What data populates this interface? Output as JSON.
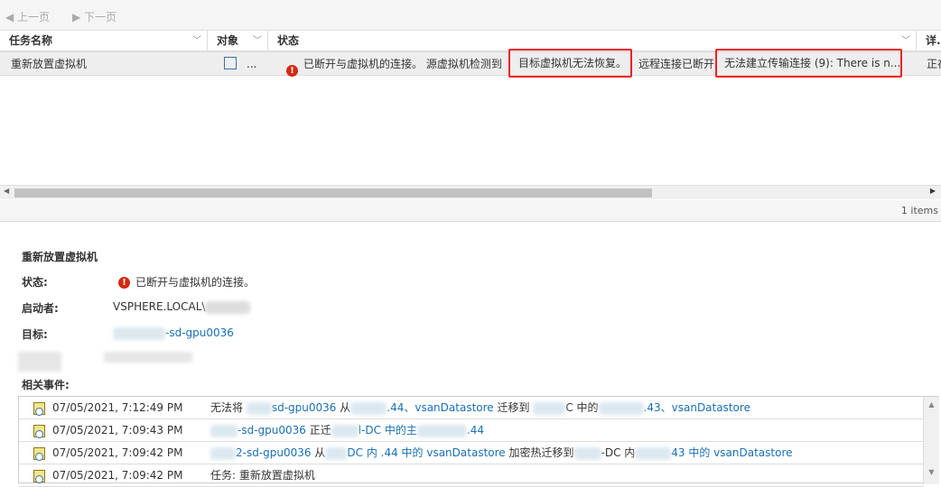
{
  "nav": {
    "prev": "上一页",
    "next": "下一页"
  },
  "columns": [
    "任务名称",
    "对象",
    "状态",
    "详..."
  ],
  "task_row": {
    "name": "重新放置虚拟机",
    "object": "...",
    "status_part1": "已断开与虚拟机的连接。 源虚拟机检测到",
    "status_box1": "目标虚拟机无法恢复。",
    "status_part2": "远程连接已断开",
    "status_box2": "无法建立传输连接 (9): There is n...",
    "detail": "正在"
  },
  "footer": {
    "count": "1 items"
  },
  "detail": {
    "title": "重新放置虚拟机",
    "status_label": "状态:",
    "status_value": "已断开与虚拟机的连接。",
    "initiator_label": "启动者:",
    "initiator_value": "VSPHERE.LOCAL\\",
    "target_label": "目标:",
    "target_value": "-sd-gpu0036",
    "events_label": "相关事件:"
  },
  "events": [
    {
      "time": "07/05/2021, 7:12:49 PM",
      "a": "无法将",
      "b": "sd-gpu0036",
      "c": "从",
      "d": ".44、vsanDatastore",
      "e": "迁移到",
      "f": "C 中的",
      "g": ".43、vsanDatastore"
    },
    {
      "time": "07/05/2021, 7:09:43 PM",
      "a": "",
      "b": "-sd-gpu0036",
      "c": "正迁",
      "d": "l-DC 中的主",
      "e": "",
      "f": "",
      "g": ".44"
    },
    {
      "time": "07/05/2021, 7:09:42 PM",
      "a": "",
      "b": "2-sd-gpu0036",
      "c": "从",
      "d": "DC 内 .44 中的 vsanDatastore",
      "e": "加密热迁移到",
      "f": "-DC 内",
      "g": "43 中的 vsanDatastore"
    },
    {
      "time": "07/05/2021, 7:09:42 PM",
      "a": "任务: 重新放置虚拟机",
      "b": "",
      "c": "",
      "d": "",
      "e": "",
      "f": "",
      "g": ""
    }
  ],
  "colors": {
    "error": "#d42a12",
    "link": "#1a6fb5",
    "highlight": "#f02020"
  }
}
